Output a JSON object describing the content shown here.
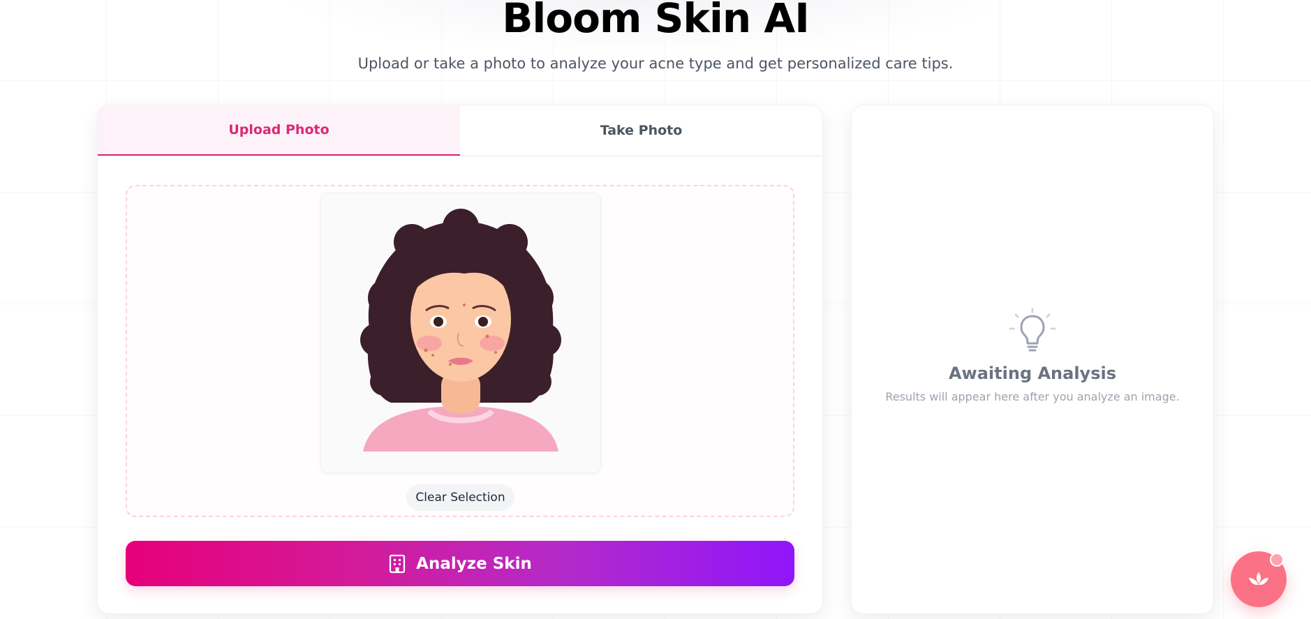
{
  "header": {
    "title": "Bloom Skin AI",
    "subtitle": "Upload or take a photo to analyze your acne type and get personalized care tips."
  },
  "tabs": [
    {
      "label": "Upload Photo",
      "active": true
    },
    {
      "label": "Take Photo",
      "active": false
    }
  ],
  "upload": {
    "clear_label": "Clear Selection",
    "preview_icon": "face-illustration"
  },
  "analyze": {
    "label": "Analyze Skin",
    "icon": "building-icon"
  },
  "results": {
    "icon": "lightbulb-icon",
    "title": "Awaiting Analysis",
    "message": "Results will appear here after you analyze an image."
  },
  "fab": {
    "icon": "lotus-icon",
    "badge_color": "#fda4af"
  },
  "colors": {
    "accent": "#db2777",
    "gradient_start": "#e6007a",
    "gradient_end": "#8f16fa",
    "fab": "#fb7185"
  }
}
